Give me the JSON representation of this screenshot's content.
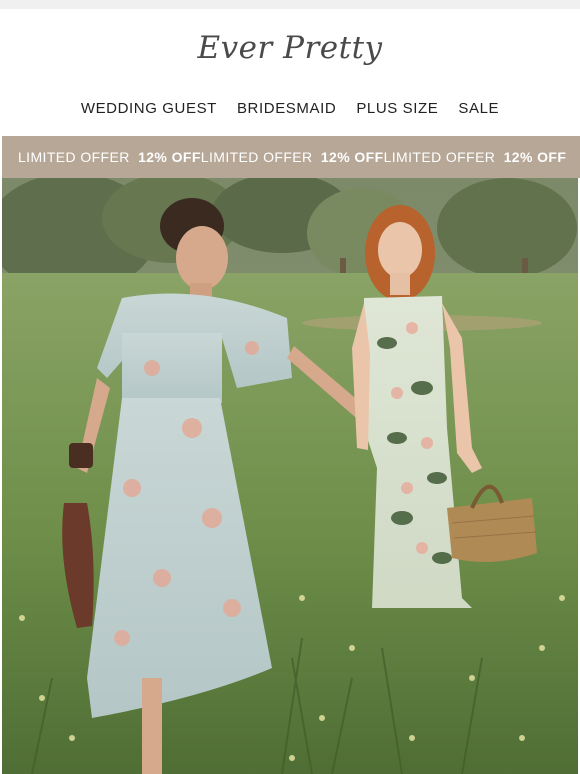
{
  "brand": {
    "logo_text": "Ever Pretty"
  },
  "nav": {
    "items": [
      {
        "label": "WEDDING GUEST"
      },
      {
        "label": "BRIDESMAID"
      },
      {
        "label": "PLUS SIZE"
      },
      {
        "label": "SALE"
      }
    ]
  },
  "banner": {
    "offers": [
      {
        "label": "LIMITED OFFER",
        "discount": "12% OFF"
      },
      {
        "label": "LIMITED OFFER",
        "discount": "12% OFF"
      },
      {
        "label": "LIMITED OFFER",
        "discount": "12% OFF"
      }
    ],
    "background": "#b7a797"
  },
  "hero": {
    "image": "two-models-floral-dresses-meadow"
  },
  "colors": {
    "text": "#222222",
    "logo": "#4a4a4a",
    "banner_text": "#ffffff"
  }
}
